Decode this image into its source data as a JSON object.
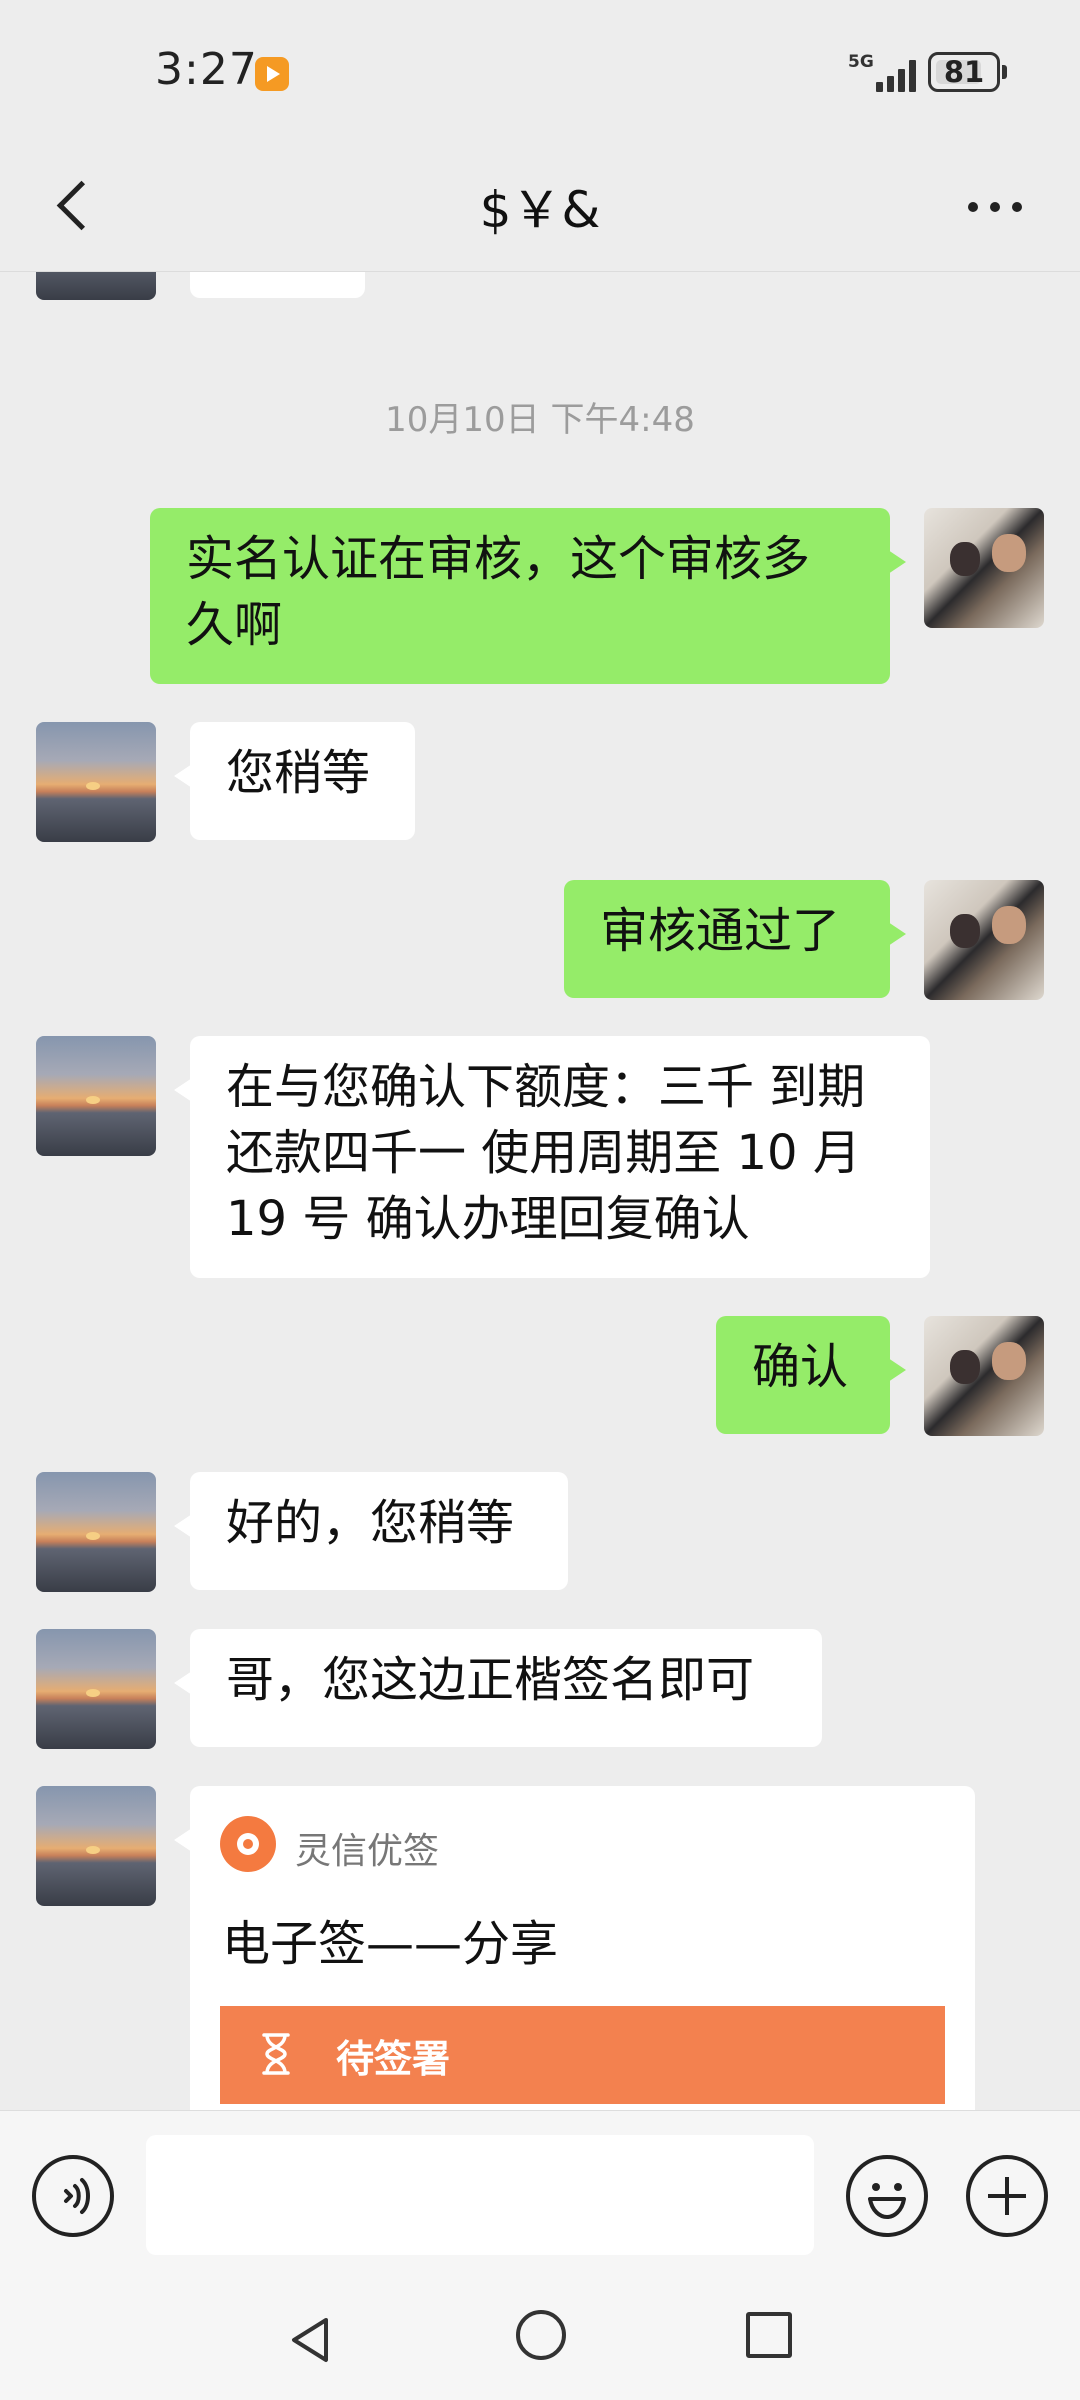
{
  "status_bar": {
    "time": "3:27",
    "app_icon": "play-badge-icon",
    "network": "5G",
    "battery": "81",
    "battery_level": 0.81
  },
  "header": {
    "title": "$￥&",
    "back_icon": "chevron-left-icon",
    "more_icon": "more-dots-icon"
  },
  "chat": {
    "timestamp": "10月10日 下午4:48",
    "messages": [
      {
        "side": "right",
        "text_lines": [
          "实名认证在审核，这个审核多",
          "久啊"
        ]
      },
      {
        "side": "left",
        "text": "您稍等"
      },
      {
        "side": "right",
        "text": "审核通过了"
      },
      {
        "side": "left",
        "text_lines": [
          "在与您确认下额度：三千 到期",
          "还款四千一 使用周期至 10 月",
          "19 号 确认办理回复确认"
        ]
      },
      {
        "side": "right",
        "text": "确认"
      },
      {
        "side": "left",
        "text": "好的，您稍等"
      },
      {
        "side": "left",
        "text": "哥，您这边正楷签名即可"
      }
    ],
    "card": {
      "source": "灵信优签",
      "title": "电子签——分享",
      "action_label": "待签署",
      "action_icon": "hourglass-icon",
      "accent_color": "#f3814f"
    }
  },
  "input_bar": {
    "placeholder": "",
    "voice_icon": "voice-icon",
    "emoji_icon": "emoji-icon",
    "plus_icon": "plus-icon"
  },
  "colors": {
    "background": "#ededed",
    "sent_bubble": "#95ec69",
    "received_bubble": "#ffffff"
  }
}
